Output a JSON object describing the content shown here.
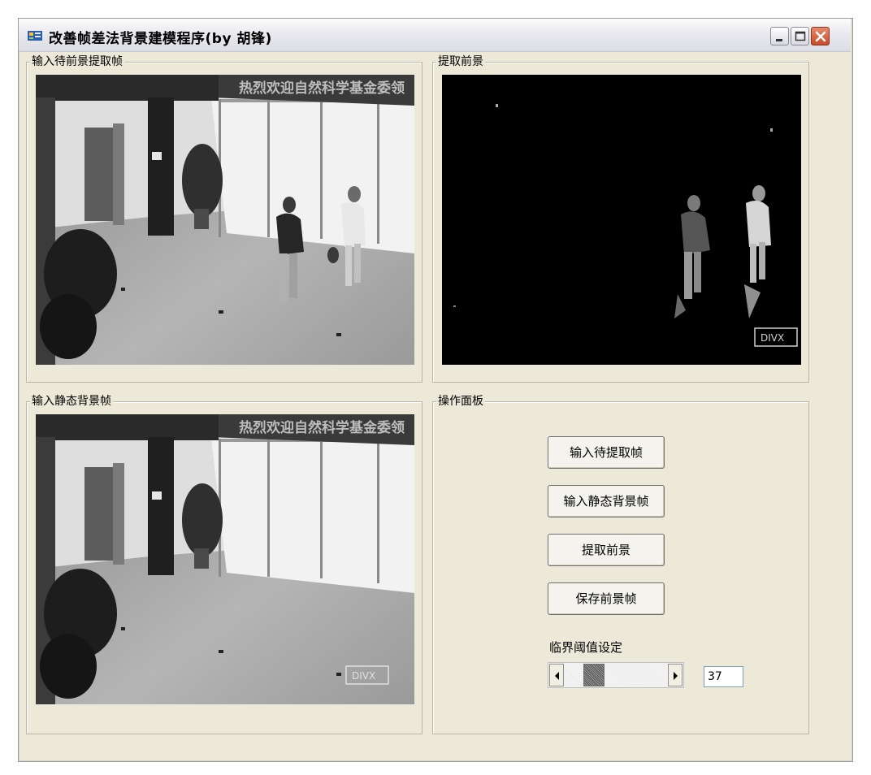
{
  "window": {
    "title": "改善帧差法背景建模程序(by 胡锋)"
  },
  "groups": {
    "input_frame": "输入待前景提取帧",
    "foreground": "提取前景",
    "background_frame": "输入静态背景帧",
    "control_panel": "操作面板"
  },
  "images": {
    "banner_text": "热烈欢迎自然科学基金委领",
    "watermark": "DIVX"
  },
  "buttons": {
    "input_frame": "输入待提取帧",
    "input_background": "输入静态背景帧",
    "extract_foreground": "提取前景",
    "save_foreground": "保存前景帧"
  },
  "threshold": {
    "label": "临界阈值设定",
    "value": "37",
    "slider_fraction": 0.24
  },
  "colors": {
    "window_bg": "#ece9d8",
    "close_button": "#c84a2a"
  }
}
